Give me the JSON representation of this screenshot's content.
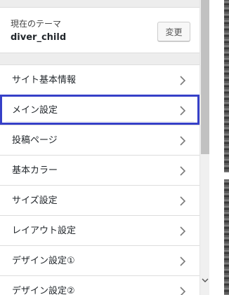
{
  "theme": {
    "label": "現在のテーマ",
    "name": "diver_child",
    "change_button": "変更"
  },
  "menu": {
    "items": [
      {
        "label": "サイト基本情報",
        "icon": "chevron-right-icon"
      },
      {
        "label": "メイン設定",
        "icon": "chevron-right-icon",
        "active": true
      },
      {
        "label": "投稿ページ",
        "icon": "chevron-right-icon"
      },
      {
        "label": "基本カラー",
        "icon": "chevron-right-icon"
      },
      {
        "label": "サイズ設定",
        "icon": "chevron-right-icon"
      },
      {
        "label": "レイアウト設定",
        "icon": "chevron-right-icon"
      },
      {
        "label": "デザイン設定①",
        "icon": "chevron-right-icon"
      },
      {
        "label": "デザイン設定②",
        "icon": "chevron-right-icon"
      }
    ]
  },
  "colors": {
    "active_outline": "#3640c8",
    "panel_bg": "#ededed",
    "item_bg": "#ffffff"
  },
  "scrollbar": {
    "down_icon": "chevron-down-icon"
  }
}
